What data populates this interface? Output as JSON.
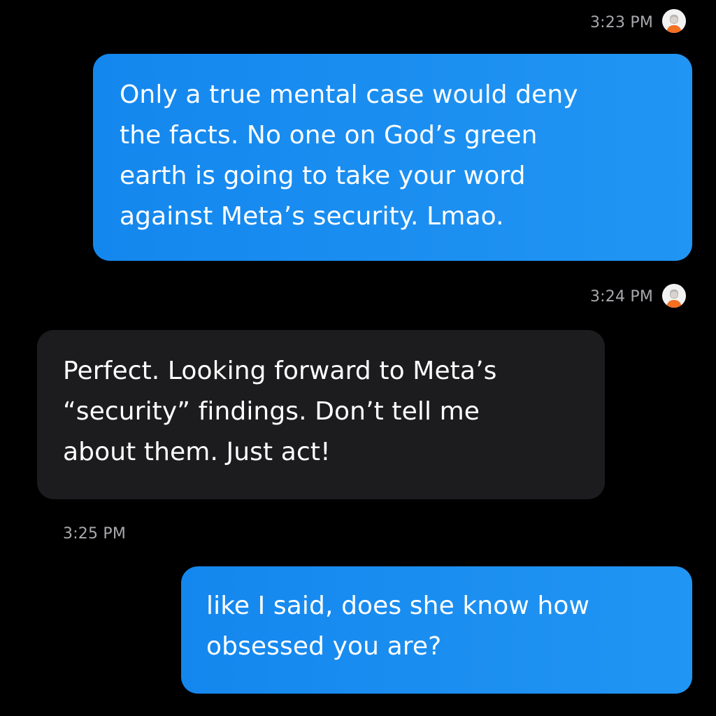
{
  "messages": [
    {
      "direction": "sent",
      "timestamp": "3:23 PM",
      "text": "Only a true mental case would deny\nthe facts.  No one on God’s green\nearth is going to take your word\nagainst Meta’s security. Lmao."
    },
    {
      "direction": "received",
      "timestamp": "3:24 PM",
      "text": "Perfect. Looking forward to Meta’s\n“security” findings. Don’t tell me\nabout them. Just act!"
    },
    {
      "direction": "sent",
      "timestamp": "3:25 PM",
      "text": "like I said, does she know how\nobsessed you are?"
    }
  ],
  "avatar_icon": "user-avatar-icon",
  "colors": {
    "background": "#000000",
    "sent_bubble": "#1f8ef1",
    "received_bubble": "#1c1c1e",
    "timestamp": "#a8a8ad",
    "avatar_shirt": "#f36f21"
  }
}
